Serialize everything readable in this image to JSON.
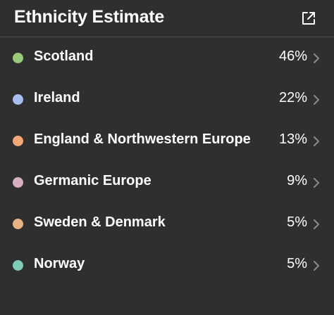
{
  "header": {
    "title": "Ethnicity Estimate",
    "external_icon": "external-link-icon"
  },
  "rows": [
    {
      "label": "Scotland",
      "percent": "46%",
      "color": "#9bc97c"
    },
    {
      "label": "Ireland",
      "percent": "22%",
      "color": "#a7bff0"
    },
    {
      "label": "England & Northwestern Europe",
      "percent": "13%",
      "color": "#f2a877"
    },
    {
      "label": "Germanic Europe",
      "percent": "9%",
      "color": "#d7afc2"
    },
    {
      "label": "Sweden & Denmark",
      "percent": "5%",
      "color": "#e9b481"
    },
    {
      "label": "Norway",
      "percent": "5%",
      "color": "#7fcdb9"
    }
  ],
  "colors": {
    "background": "#2f2f2f",
    "divider": "#4a4a4a",
    "text": "#ffffff",
    "chevron": "#8a8a8a"
  },
  "icons": {
    "row_chevron": "chevron-right-icon"
  }
}
